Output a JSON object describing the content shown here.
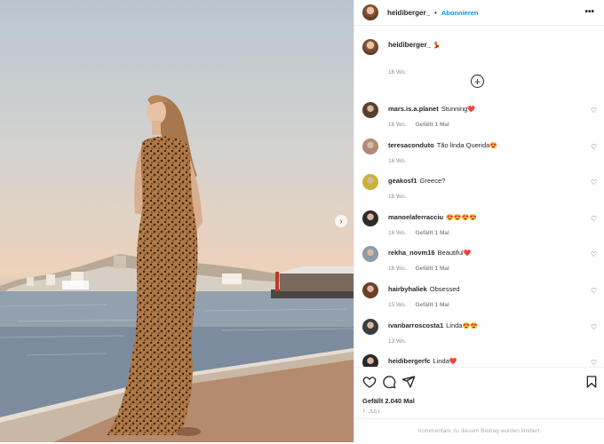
{
  "header": {
    "username": "heidiberger_",
    "separator": "•",
    "follow_label": "Abonnieren",
    "more_icon": "more-horizontal-icon"
  },
  "caption": {
    "username": "heidiberger_",
    "emoji": "💃",
    "age": "16 Wo."
  },
  "load_more_icon": "plus-circle-icon",
  "comments": [
    {
      "user": "mars.is.a.planet",
      "text": "Stunning",
      "emoji": "❤️",
      "age": "16 Wo.",
      "likes": "Gefällt 1 Mal",
      "avatar_color": "#5a3e2e"
    },
    {
      "user": "teresaconduto",
      "text": "Tão linda Querida",
      "emoji": "😍",
      "age": "16 Wo.",
      "likes": "",
      "avatar_color": "#b08a78"
    },
    {
      "user": "geakosf1",
      "text": "Greece?",
      "emoji": "",
      "age": "16 Wo.",
      "likes": "",
      "avatar_color": "#c9b23b"
    },
    {
      "user": "manoelaferracciu",
      "text": "",
      "emoji": "😍😍😍😍",
      "age": "16 Wo.",
      "likes": "Gefällt 1 Mal",
      "avatar_color": "#2c2c2c"
    },
    {
      "user": "rekha_novm16",
      "text": "Beautiful",
      "emoji": "❤️",
      "age": "16 Wo.",
      "likes": "Gefällt 1 Mal",
      "avatar_color": "#8f9aa5"
    },
    {
      "user": "hairbyhaliek",
      "text": "Obsessed",
      "emoji": "",
      "age": "15 Wo.",
      "likes": "Gefällt 1 Mal",
      "avatar_color": "#6b3f2a"
    },
    {
      "user": "ivanbarroscosta1",
      "text": "Linda",
      "emoji": "😍😍",
      "age": "13 Wo.",
      "likes": "",
      "avatar_color": "#3d3d3d"
    },
    {
      "user": "heidibergerfc",
      "text": "Linda",
      "emoji": "❤️",
      "age": "",
      "likes": "",
      "avatar_color": "#2a2a2a"
    }
  ],
  "actions": {
    "like_icon": "heart-icon",
    "comment_icon": "comment-icon",
    "share_icon": "share-icon",
    "save_icon": "bookmark-icon",
    "likes_label": "Gefällt 2.040 Mal",
    "date": "7. JULI",
    "comments_limited": "Kommentare zu diesem Beitrag wurden limitiert."
  },
  "photo": {
    "next_icon": "chevron-right-icon"
  }
}
